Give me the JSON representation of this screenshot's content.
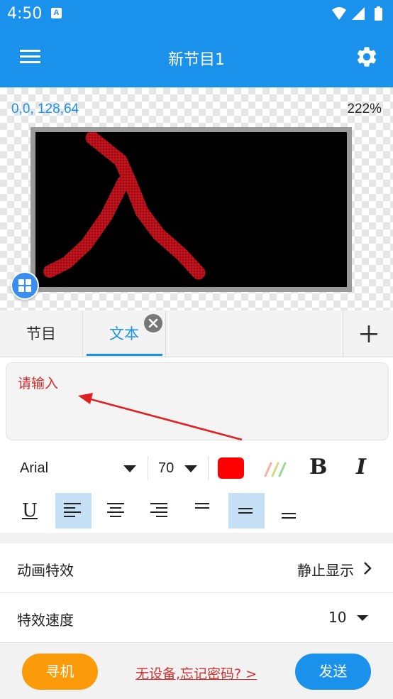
{
  "status_bar": {
    "time": "4:50"
  },
  "app_bar": {
    "title": "新节目1"
  },
  "preview": {
    "coordinates": "0,0, 128,64",
    "zoom": "222%",
    "led_character": "入"
  },
  "tabs": {
    "program_label": "节目",
    "text_label": "文本"
  },
  "text_input": {
    "value": "请输入"
  },
  "format": {
    "font_name": "Arial",
    "font_size": "70",
    "text_color": "#ff0000",
    "bold_label": "B",
    "italic_label": "I",
    "underline_label": "U",
    "horizontal_align": "left",
    "vertical_align": "middle"
  },
  "settings": {
    "animation": {
      "label": "动画特效",
      "value": "静止显示"
    },
    "speed": {
      "label": "特效速度",
      "value": "10"
    }
  },
  "bottom_bar": {
    "find_label": "寻机",
    "forgot_label": "无设备,忘记密码? >",
    "send_label": "发送"
  },
  "colors": {
    "primary": "#1a91ea",
    "find_button": "#fb9b0a",
    "hint_red": "#d52b2b",
    "led_red": "#c0141e"
  }
}
